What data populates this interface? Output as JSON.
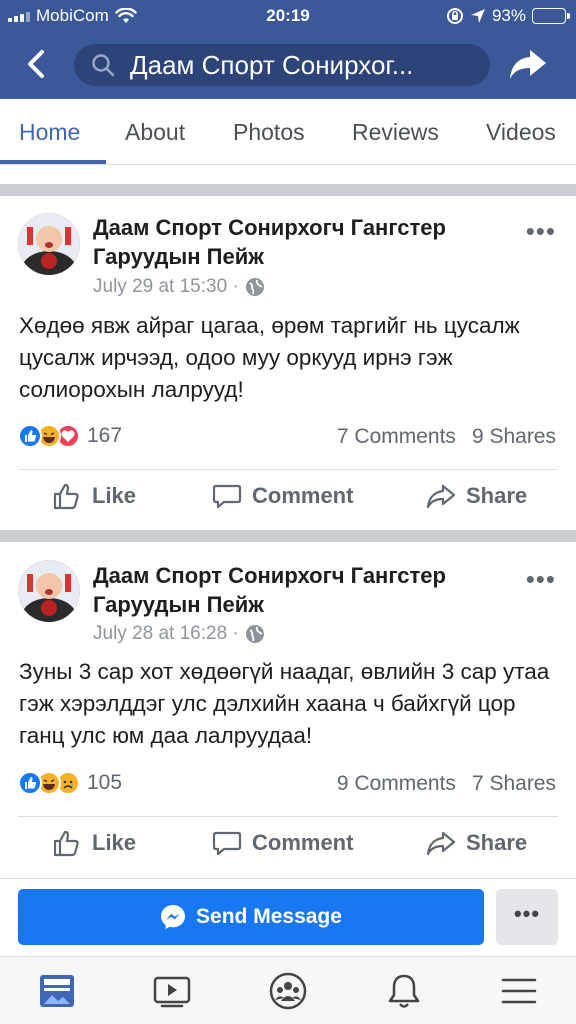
{
  "status_bar": {
    "carrier": "MobiCom",
    "time": "20:19",
    "battery": "93%",
    "battery_level": 0.93
  },
  "header": {
    "page_title": "Даам Спорт Сонирхог...",
    "icons": [
      "back-icon",
      "search-icon",
      "share-icon"
    ]
  },
  "tabs": [
    {
      "label": "Home",
      "active": true
    },
    {
      "label": "About"
    },
    {
      "label": "Photos"
    },
    {
      "label": "Reviews"
    },
    {
      "label": "Videos"
    }
  ],
  "posts": [
    {
      "author": "Даам Спорт Сонирхогч Гангстер Гаруудын Пейж",
      "date": "July 29 at 15:30 ·",
      "text": "Хөдөө явж айраг цагаа, өрөм таргийг нь цусалж цусалж ирчээд, одоо муу оркууд ирнэ гэж солиорохын лалрууд!",
      "reactions": [
        "like",
        "haha",
        "love"
      ],
      "reaction_count": "167",
      "comments": "7 Comments",
      "shares": "9 Shares"
    },
    {
      "author": "Даам Спорт Сонирхогч Гангстер Гаруудын Пейж",
      "date": "July 28 at 16:28 ·",
      "text": "Зуны 3 сар хот хөдөөгүй наадаг, өвлийн 3 сар утаа гэж хэрэлддэг улс дэлхийн хаана ч байхгүй цор ганц улс юм даа лалруудаа!",
      "reactions": [
        "like",
        "haha",
        "sad"
      ],
      "reaction_count": "105",
      "comments": "9 Comments",
      "shares": "7 Shares"
    }
  ],
  "actions": {
    "like": "Like",
    "comment": "Comment",
    "share": "Share"
  },
  "more_label": "•••",
  "send_message": {
    "label": "Send Message",
    "icon": "messenger-icon"
  },
  "bottom_nav": [
    "news-feed-icon",
    "watch-icon",
    "groups-icon",
    "notifications-icon",
    "menu-icon"
  ],
  "colors": {
    "header": "#3b5998",
    "accent": "#4267b2",
    "send_button": "#1877f2",
    "like_blue": "#1877f2",
    "love_red": "#f33e58",
    "haha_yellow": "#f7b125"
  }
}
